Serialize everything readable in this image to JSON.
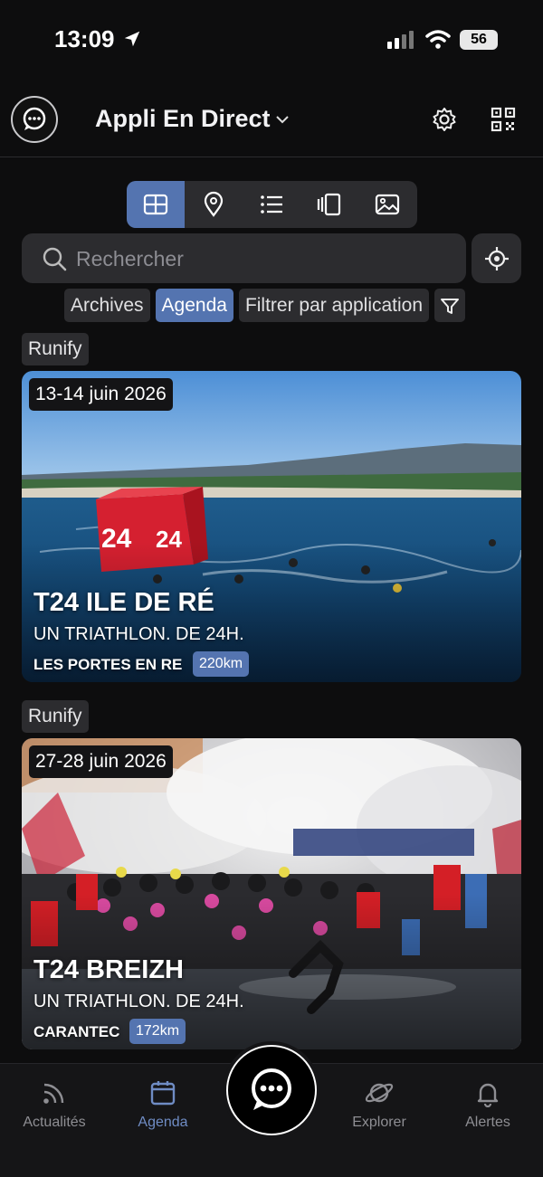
{
  "status": {
    "time": "13:09",
    "battery": "56"
  },
  "header": {
    "title": "Appli En Direct"
  },
  "views": [
    "grid-icon",
    "map-pin-icon",
    "list-icon",
    "carousel-icon",
    "image-icon"
  ],
  "search": {
    "placeholder": "Rechercher"
  },
  "filters": {
    "archives": "Archives",
    "agenda": "Agenda",
    "by_app": "Filtrer par application"
  },
  "events": [
    {
      "source": "Runify",
      "date": "13-14 juin 2026",
      "title": "T24 ILE DE RÉ",
      "subtitle": "UN TRIATHLON. DE 24H.",
      "location": "LES PORTES EN RE",
      "distance": "220km"
    },
    {
      "source": "Runify",
      "date": "27-28 juin 2026",
      "title": "T24 BREIZH",
      "subtitle": "UN TRIATHLON. DE 24H.",
      "location": "CARANTEC",
      "distance": "172km"
    }
  ],
  "tabs": {
    "news": "Actualités",
    "agenda": "Agenda",
    "explore": "Explorer",
    "alerts": "Alertes"
  },
  "colors": {
    "accent": "#5474b0",
    "background": "#0d0d0e",
    "surface": "#2c2c2f"
  }
}
